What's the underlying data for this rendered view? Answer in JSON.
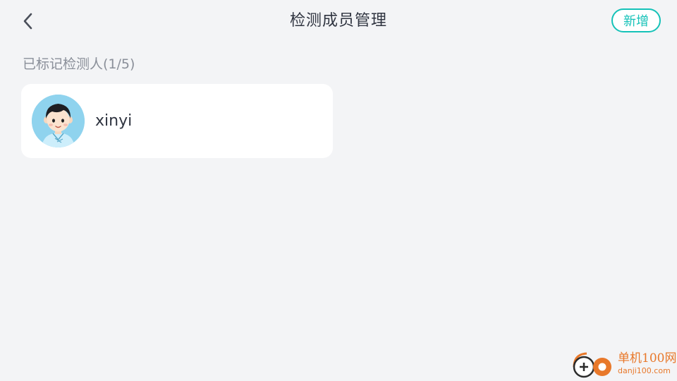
{
  "header": {
    "title": "检测成员管理",
    "add_label": "新增",
    "back_icon": "chevron-left-icon"
  },
  "section": {
    "label": "已标记检测人(1/5)"
  },
  "members": [
    {
      "name": "xinyi",
      "avatar": "boy-avatar"
    }
  ],
  "watermark": {
    "title": "单机100网",
    "domain": "danji100.com"
  },
  "colors": {
    "background": "#f3f4f6",
    "accent": "#15c2b8",
    "card": "#ffffff",
    "title_text": "#2f3440",
    "secondary_text": "#8a8f99",
    "watermark": "#e8782a"
  }
}
